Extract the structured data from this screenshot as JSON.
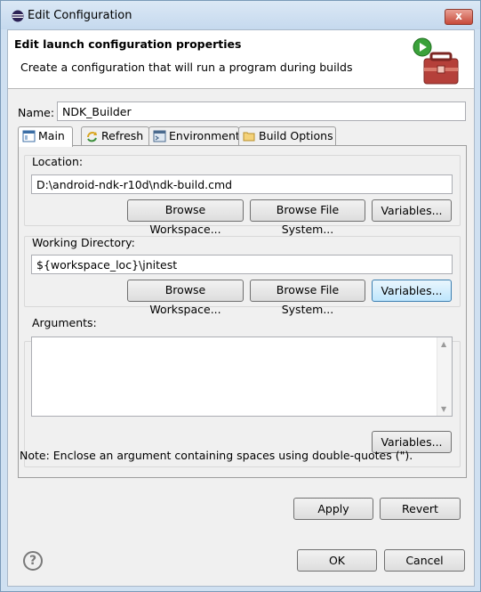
{
  "window": {
    "title": "Edit Configuration",
    "close_label": "x"
  },
  "header": {
    "title": "Edit launch configuration properties",
    "description": "Create a configuration that will run a program during builds"
  },
  "name": {
    "label": "Name:",
    "value": "NDK_Builder"
  },
  "tabs": [
    {
      "label": "Main",
      "icon": "main-tab-icon",
      "active": true
    },
    {
      "label": "Refresh",
      "icon": "refresh-icon",
      "active": false
    },
    {
      "label": "Environment",
      "icon": "environment-icon",
      "active": false
    },
    {
      "label": "Build Options",
      "icon": "folder-icon",
      "active": false
    }
  ],
  "location": {
    "label": "Location:",
    "value": "D:\\android-ndk-r10d\\ndk-build.cmd",
    "browse_workspace": "Browse Workspace...",
    "browse_file_system": "Browse File System...",
    "variables": "Variables..."
  },
  "working_directory": {
    "label": "Working Directory:",
    "value": "${workspace_loc}\\jnitest",
    "browse_workspace": "Browse Workspace...",
    "browse_file_system": "Browse File System...",
    "variables": "Variables..."
  },
  "arguments": {
    "label": "Arguments:",
    "value": "",
    "variables": "Variables...",
    "note": "Note: Enclose an argument containing spaces using double-quotes (\")."
  },
  "actions": {
    "apply": "Apply",
    "revert": "Revert",
    "ok": "OK",
    "cancel": "Cancel",
    "help": "?"
  },
  "colors": {
    "title_bar": "#c5d9ee",
    "close_button": "#c74a3a",
    "dialog_background": "#f0f0f0",
    "focus_button": "#bee6fd"
  }
}
